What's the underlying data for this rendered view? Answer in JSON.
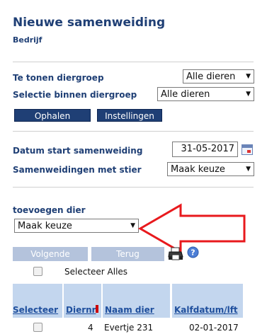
{
  "page": {
    "title": "Nieuwe samenweiding",
    "subtitle": "Bedrijf"
  },
  "filters": {
    "diergroep_label": "Te tonen diergroep",
    "diergroep_value": "Alle dieren",
    "selectie_label": "Selectie binnen diergroep",
    "selectie_value": "Alle dieren",
    "ophalen_label": "Ophalen",
    "instellingen_label": "Instellingen"
  },
  "samenweiding": {
    "datum_label": "Datum start samenweiding",
    "datum_value": "31-05-2017",
    "stier_label": "Samenweidingen met stier",
    "stier_value": "Maak keuze"
  },
  "add_animal": {
    "label": "toevoegen dier",
    "value": "Maak keuze",
    "arrow_color": "#e8191d"
  },
  "actions": {
    "volgende_label": "Volgende",
    "terug_label": "Terug",
    "select_all_label": "Selecteer Alles"
  },
  "table": {
    "headers": [
      "Selecteer",
      "Diernr",
      "Naam dier",
      "Kalfdatum/lft"
    ],
    "rows": [
      {
        "diernr": "4",
        "naam": "Evertje 231",
        "kalfdatum": "02-01-2017"
      }
    ]
  },
  "colors": {
    "brand": "#1f3f75",
    "header_bg": "#c3d6ee",
    "disabled_button": "#b4c3dc"
  }
}
